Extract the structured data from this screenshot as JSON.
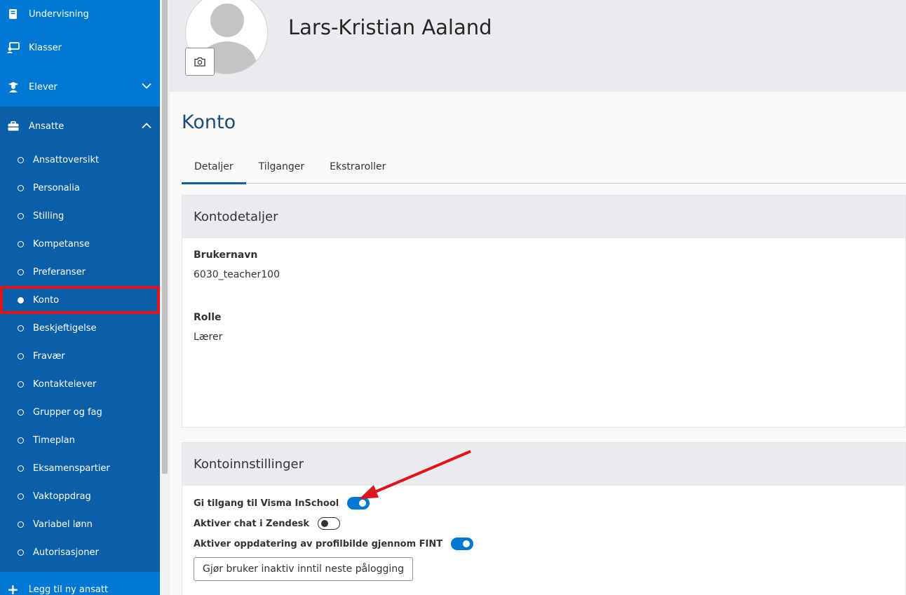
{
  "sidebar": {
    "top_items": [
      {
        "label": "Undervisning",
        "icon": "book-icon"
      },
      {
        "label": "Klasser",
        "icon": "classroom-icon"
      },
      {
        "label": "Elever",
        "icon": "students-icon"
      }
    ],
    "section": {
      "label": "Ansatte",
      "icon": "briefcase-icon"
    },
    "sub_items": [
      {
        "label": "Ansattoversikt"
      },
      {
        "label": "Personalia"
      },
      {
        "label": "Stilling"
      },
      {
        "label": "Kompetanse"
      },
      {
        "label": "Preferanser"
      },
      {
        "label": "Konto",
        "active": true
      },
      {
        "label": "Beskjeftigelse"
      },
      {
        "label": "Fravær"
      },
      {
        "label": "Kontaktelever"
      },
      {
        "label": "Grupper og fag"
      },
      {
        "label": "Timeplan"
      },
      {
        "label": "Eksamenspartier"
      },
      {
        "label": "Vaktoppdrag"
      },
      {
        "label": "Variabel lønn"
      },
      {
        "label": "Autorisasjoner"
      }
    ],
    "bottom_label": "Legg til ny ansatt"
  },
  "header": {
    "user_name": "Lars-Kristian Aaland"
  },
  "main": {
    "page_title": "Konto",
    "tabs": [
      {
        "label": "Detaljer",
        "active": true
      },
      {
        "label": "Tilganger"
      },
      {
        "label": "Ekstraroller"
      }
    ],
    "account_details": {
      "title": "Kontodetaljer",
      "username_label": "Brukernavn",
      "username_value": "6030_teacher100",
      "role_label": "Rolle",
      "role_value": "Lærer"
    },
    "account_settings": {
      "title": "Kontoinnstillinger",
      "toggles": [
        {
          "label": "Gi tilgang til Visma InSchool",
          "on": true
        },
        {
          "label": "Aktiver chat i Zendesk",
          "on": false
        },
        {
          "label": "Aktiver oppdatering av profilbilde gjennom FINT",
          "on": true
        }
      ],
      "inactive_button": "Gjør bruker inaktiv inntil neste pålogging"
    }
  },
  "colors": {
    "sidebar_dark": "#0b5ea8",
    "sidebar_light": "#0078d4",
    "highlight": "#e2141b",
    "toggle_on": "#0078d4"
  }
}
